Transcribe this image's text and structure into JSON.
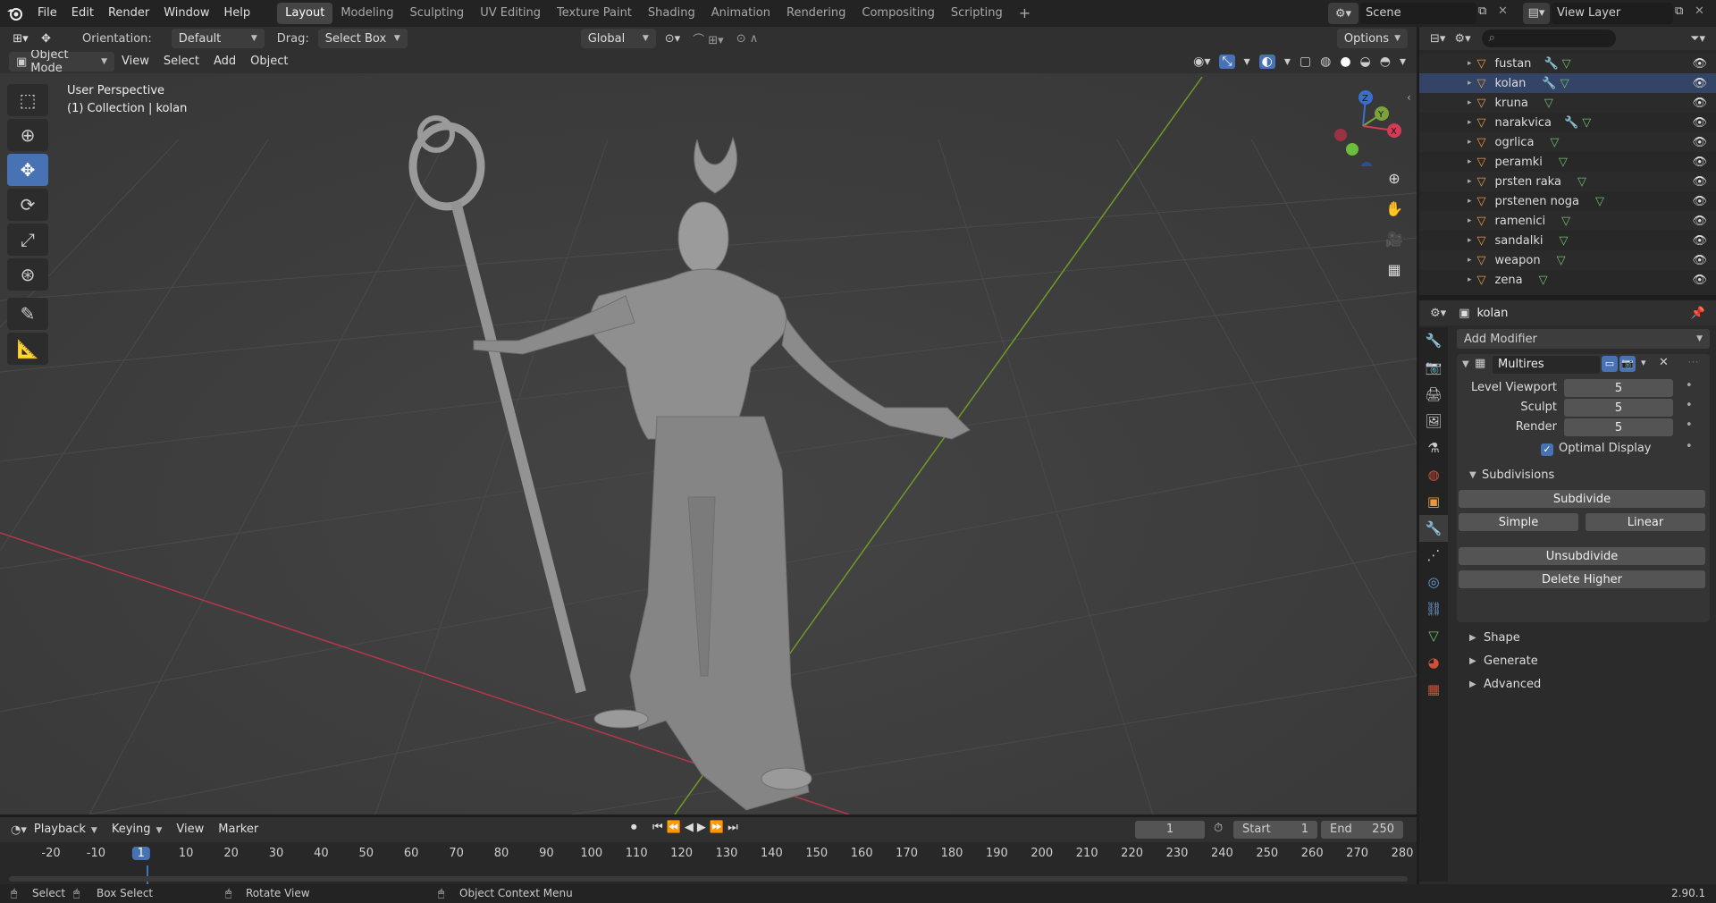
{
  "menu": [
    "File",
    "Edit",
    "Render",
    "Window",
    "Help"
  ],
  "workspaces": [
    "Layout",
    "Modeling",
    "Sculpting",
    "UV Editing",
    "Texture Paint",
    "Shading",
    "Animation",
    "Rendering",
    "Compositing",
    "Scripting"
  ],
  "scene": "Scene",
  "view_layer": "View Layer",
  "toolbar": {
    "orientation_label": "Orientation:",
    "orientation_value": "Default",
    "drag_label": "Drag:",
    "drag_value": "Select Box",
    "transform_value": "Global",
    "options_label": "Options"
  },
  "header": {
    "mode": "Object Mode",
    "view": "View",
    "select": "Select",
    "add": "Add",
    "object": "Object"
  },
  "viewport": {
    "perspective": "User Perspective",
    "collection": "(1) Collection | kolan"
  },
  "outliner": {
    "items": [
      {
        "name": "fustan",
        "mod": true
      },
      {
        "name": "kolan",
        "mod": true
      },
      {
        "name": "kruna",
        "mod": false
      },
      {
        "name": "narakvica",
        "mod": true
      },
      {
        "name": "ogrlica",
        "mod": false
      },
      {
        "name": "peramki",
        "mod": false
      },
      {
        "name": "prsten raka",
        "mod": false
      },
      {
        "name": "prstenen noga",
        "mod": false
      },
      {
        "name": "ramenici",
        "mod": false
      },
      {
        "name": "sandalki",
        "mod": false
      },
      {
        "name": "weapon",
        "mod": false
      },
      {
        "name": "zena",
        "mod": false
      }
    ]
  },
  "properties": {
    "object": "kolan",
    "add_modifier": "Add Modifier",
    "modifier_name": "Multires",
    "level_viewport_label": "Level Viewport",
    "level_viewport": "5",
    "sculpt_label": "Sculpt",
    "sculpt": "5",
    "render_label": "Render",
    "render": "5",
    "optimal_display": "Optimal Display",
    "subdivisions": "Subdivisions",
    "subdivide": "Subdivide",
    "simple": "Simple",
    "linear": "Linear",
    "unsubdivide": "Unsubdivide",
    "delete_higher": "Delete Higher",
    "shape": "Shape",
    "generate": "Generate",
    "advanced": "Advanced"
  },
  "timeline": {
    "playback": "Playback",
    "keying": "Keying",
    "view": "View",
    "marker": "Marker",
    "current_frame": "1",
    "start_label": "Start",
    "start": "1",
    "end_label": "End",
    "end": "250",
    "ticks": [
      "-20",
      "-10",
      "1",
      "10",
      "20",
      "30",
      "40",
      "50",
      "60",
      "70",
      "80",
      "90",
      "100",
      "110",
      "120",
      "130",
      "140",
      "150",
      "160",
      "170",
      "180",
      "190",
      "200",
      "210",
      "220",
      "230",
      "240",
      "250",
      "260",
      "270",
      "280"
    ]
  },
  "status": {
    "select": "Select",
    "box_select": "Box Select",
    "rotate_view": "Rotate View",
    "context_menu": "Object Context Menu",
    "version": "2.90.1"
  },
  "colors": {
    "accent": "#4772b3",
    "x_axis": "#c1384a",
    "y_axis": "#6f9a2a",
    "object_orange": "#e89a3b",
    "mod_blue": "#6f9fd8",
    "mesh_green": "#6fc06f"
  }
}
